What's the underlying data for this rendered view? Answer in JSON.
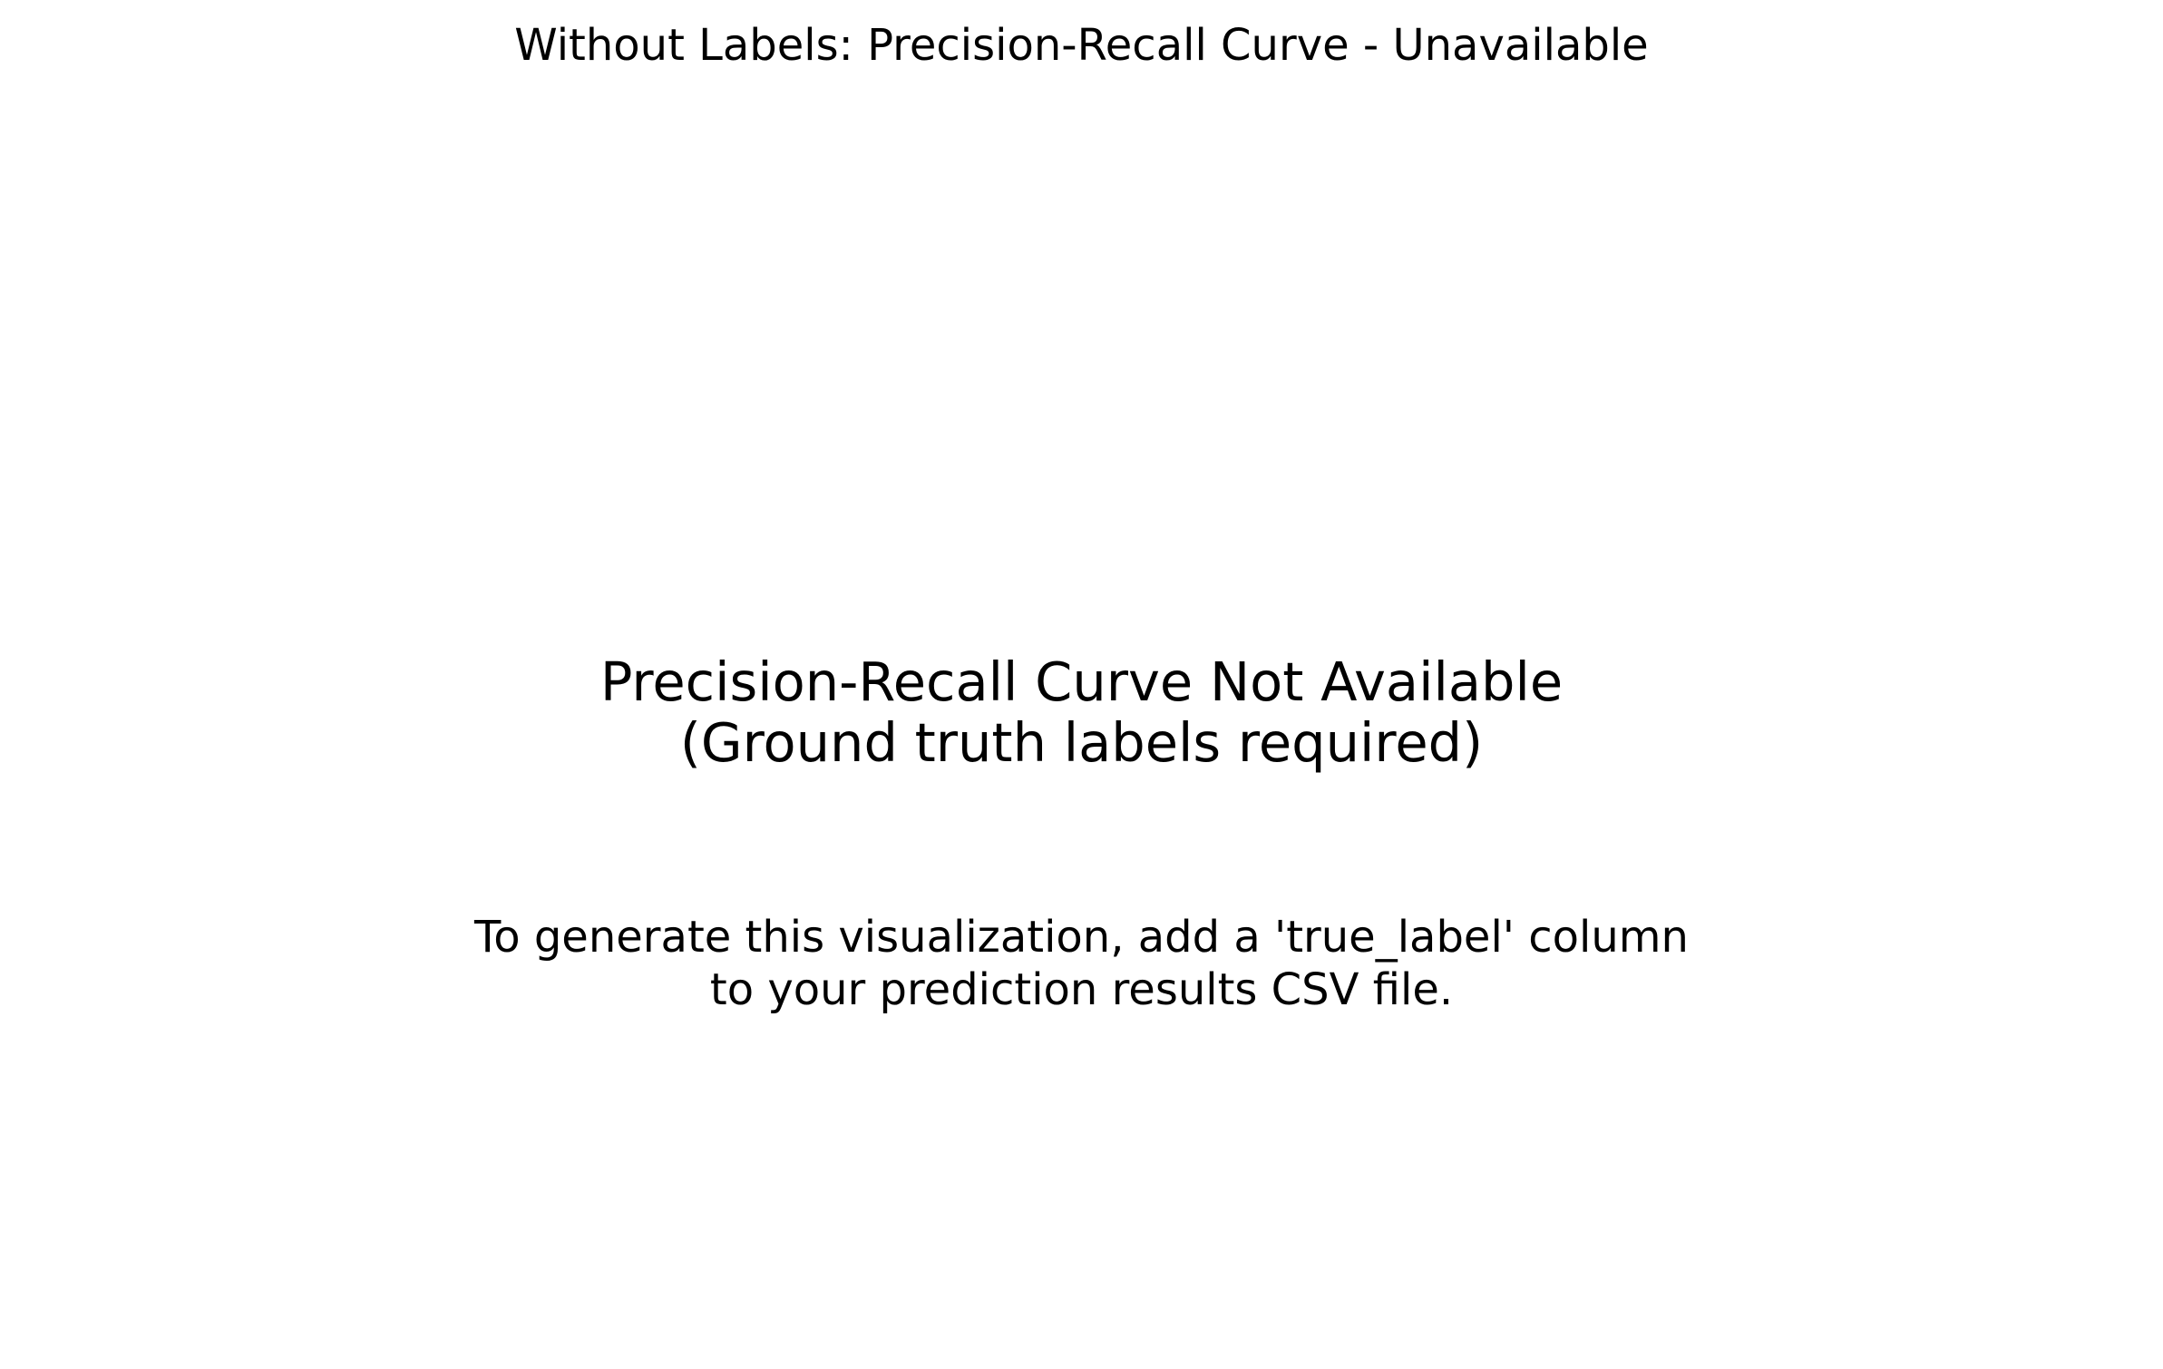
{
  "chart_data": {
    "type": "line",
    "title": "Without Labels: Precision-Recall Curve - Unavailable",
    "series": [],
    "annotations": [
      {
        "lines": [
          "Precision-Recall Curve Not Available",
          "(Ground truth labels required)"
        ]
      },
      {
        "lines": [
          "To generate this visualization, add a 'true_label' column",
          "to your prediction results CSV file."
        ]
      }
    ],
    "grid": false,
    "axes_visible": false
  }
}
